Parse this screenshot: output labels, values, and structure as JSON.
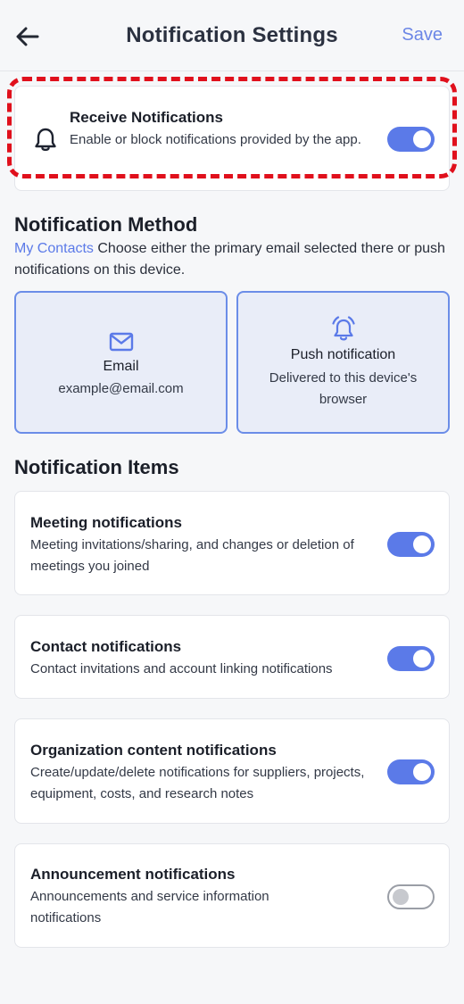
{
  "header": {
    "back_icon": "arrow-left-icon",
    "title": "Notification Settings",
    "save_label": "Save"
  },
  "receive": {
    "icon": "bell-icon",
    "title": "Receive Notifications",
    "description": "Enable or block notifications provided by the app.",
    "enabled": true
  },
  "method": {
    "heading": "Notification Method",
    "link_text": "My Contacts",
    "description": " Choose either the primary email selected there or push notifications on this device.",
    "options": [
      {
        "icon": "mail-icon",
        "label": "Email",
        "detail": "example@email.com"
      },
      {
        "icon": "bell-ringing-icon",
        "label": "Push notification",
        "detail": "Delivered to this device's browser"
      }
    ]
  },
  "items": {
    "heading": "Notification Items",
    "list": [
      {
        "title": "Meeting notifications",
        "description": "Meeting invitations/sharing, and changes or deletion of meetings you joined",
        "enabled": true
      },
      {
        "title": "Contact notifications",
        "description": "Contact invitations and account linking notifications",
        "enabled": true
      },
      {
        "title": "Organization content notifications",
        "description": "Create/update/delete notifications for suppliers, projects, equipment, costs, and research notes",
        "enabled": true
      },
      {
        "title": "Announcement notifications",
        "description": "Announcements and service information notifications",
        "enabled": false
      }
    ]
  },
  "colors": {
    "accent": "#5b7ae8",
    "highlight": "#e0101c",
    "background": "#f6f7f9"
  }
}
